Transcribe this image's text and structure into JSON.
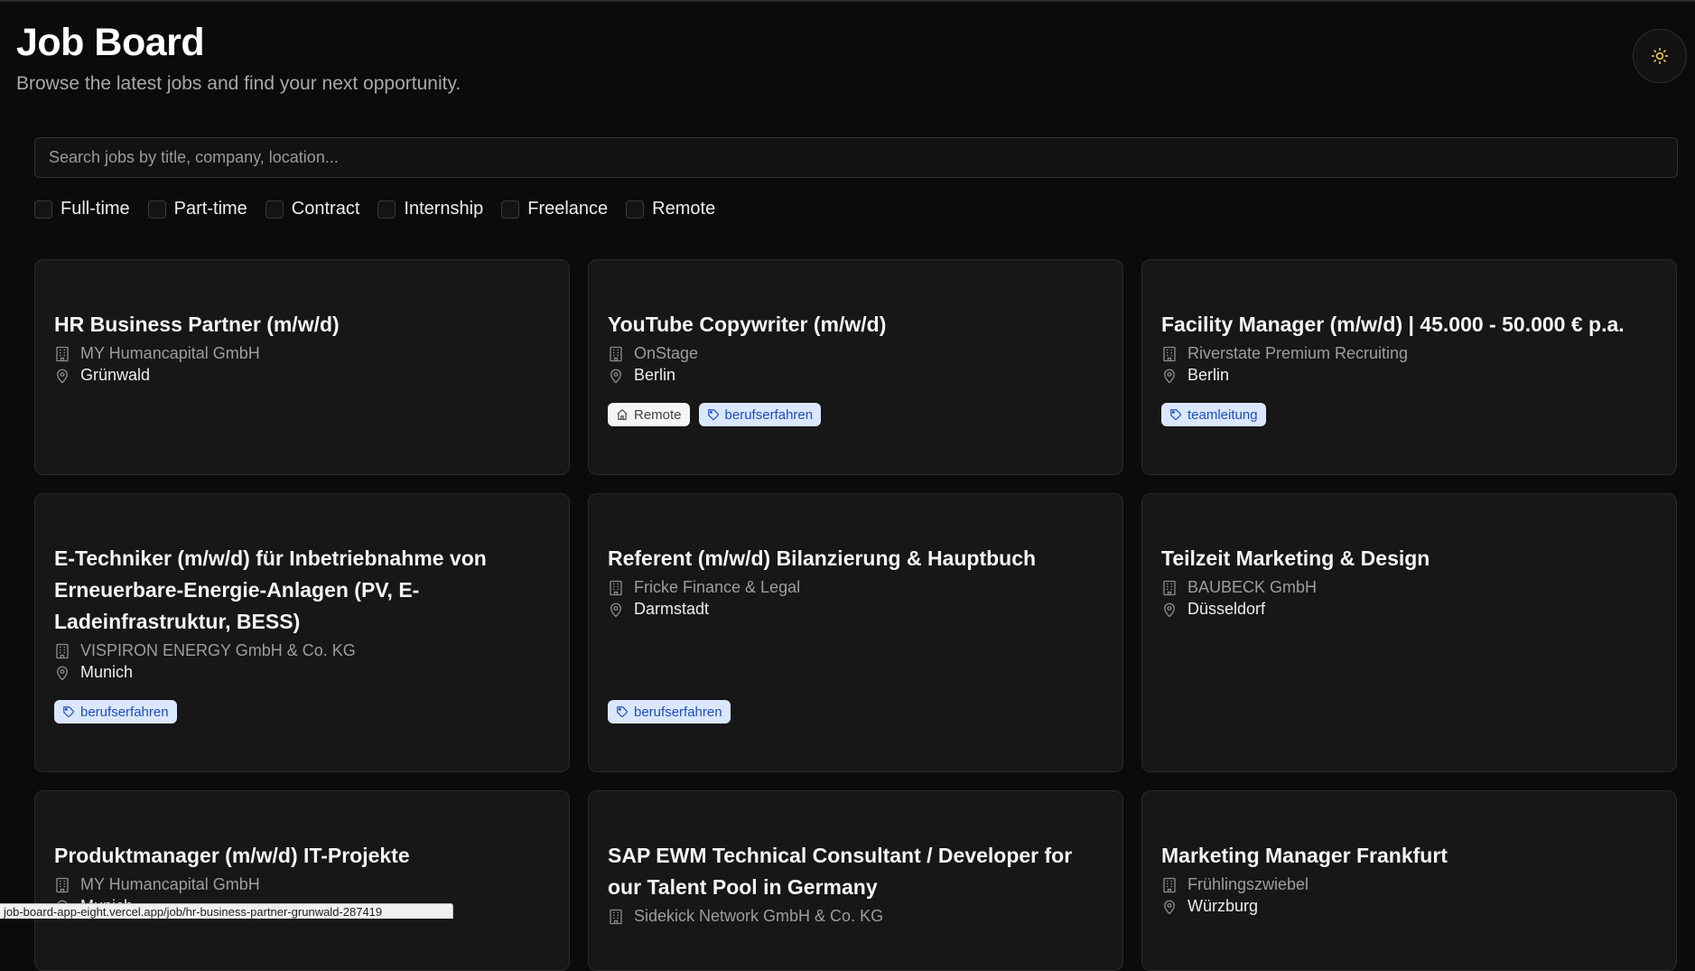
{
  "header": {
    "title": "Job Board",
    "subtitle": "Browse the latest jobs and find your next opportunity."
  },
  "theme_toggle": {
    "icon": "sun-icon"
  },
  "search": {
    "placeholder": "Search jobs by title, company, location..."
  },
  "filters": [
    {
      "label": "Full-time",
      "checked": false
    },
    {
      "label": "Part-time",
      "checked": false
    },
    {
      "label": "Contract",
      "checked": false
    },
    {
      "label": "Internship",
      "checked": false
    },
    {
      "label": "Freelance",
      "checked": false
    },
    {
      "label": "Remote",
      "checked": false
    }
  ],
  "jobs": [
    {
      "title": "HR Business Partner (m/w/d)",
      "company": "MY Humancapital GmbH",
      "location": "Grünwald",
      "remote_label": "",
      "tags": []
    },
    {
      "title": "YouTube Copywriter (m/w/d)",
      "company": "OnStage",
      "location": "Berlin",
      "remote_label": "Remote",
      "tags": [
        "berufserfahren"
      ]
    },
    {
      "title": "Facility Manager (m/w/d) | 45.000 - 50.000 € p.a.",
      "company": "Riverstate Premium Recruiting",
      "location": "Berlin",
      "remote_label": "",
      "tags": [
        "teamleitung"
      ]
    },
    {
      "title": "E-Techniker (m/w/d) für Inbetriebnahme von Erneuerbare-Energie-Anlagen (PV, E-Ladeinfrastruktur, BESS)",
      "company": "VISPIRON ENERGY GmbH & Co. KG",
      "location": "Munich",
      "remote_label": "",
      "tags": [
        "berufserfahren"
      ]
    },
    {
      "title": "Referent (m/w/d) Bilanzierung & Hauptbuch",
      "company": "Fricke Finance & Legal",
      "location": "Darmstadt",
      "remote_label": "",
      "tags": [
        "berufserfahren"
      ]
    },
    {
      "title": "Teilzeit Marketing & Design",
      "company": "BAUBECK GmbH",
      "location": "Düsseldorf",
      "remote_label": "",
      "tags": []
    },
    {
      "title": "Produktmanager (m/w/d) IT-Projekte",
      "company": "MY Humancapital GmbH",
      "location": "Munich",
      "remote_label": "",
      "tags": []
    },
    {
      "title": "SAP EWM Technical Consultant / Developer for our Talent Pool in Germany",
      "company": "Sidekick Network GmbH & Co. KG",
      "location": "",
      "remote_label": "",
      "tags": []
    },
    {
      "title": "Marketing Manager Frankfurt",
      "company": "Frühlingszwiebel",
      "location": "Würzburg",
      "remote_label": "",
      "tags": []
    }
  ],
  "status_bar": {
    "url": "job-board-app-eight.vercel.app/job/hr-business-partner-grunwald-287419"
  }
}
